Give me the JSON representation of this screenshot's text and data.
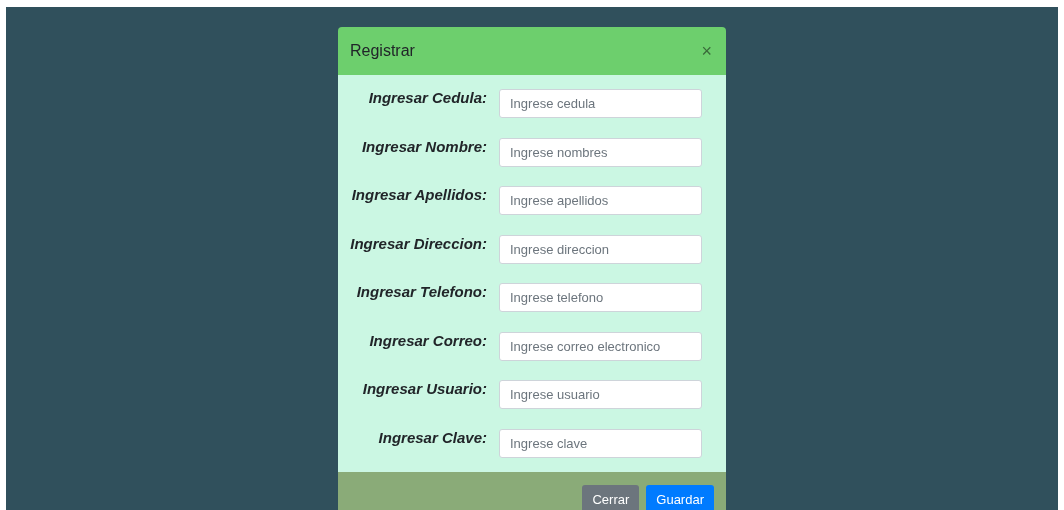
{
  "modal": {
    "title": "Registrar",
    "close_symbol": "×"
  },
  "fields": [
    {
      "label": "Ingresar Cedula:",
      "placeholder": "Ingrese cedula"
    },
    {
      "label": "Ingresar Nombre:",
      "placeholder": "Ingrese nombres"
    },
    {
      "label": "Ingresar Apellidos:",
      "placeholder": "Ingrese apellidos"
    },
    {
      "label": "Ingresar Direccion:",
      "placeholder": "Ingrese direccion"
    },
    {
      "label": "Ingresar Telefono:",
      "placeholder": "Ingrese telefono"
    },
    {
      "label": "Ingresar Correo:",
      "placeholder": "Ingrese correo electronico"
    },
    {
      "label": "Ingresar Usuario:",
      "placeholder": "Ingrese usuario"
    },
    {
      "label": "Ingresar Clave:",
      "placeholder": "Ingrese clave"
    }
  ],
  "buttons": [
    {
      "label": "Cerrar",
      "kind": "secondary"
    },
    {
      "label": "Guardar",
      "kind": "primary"
    }
  ]
}
